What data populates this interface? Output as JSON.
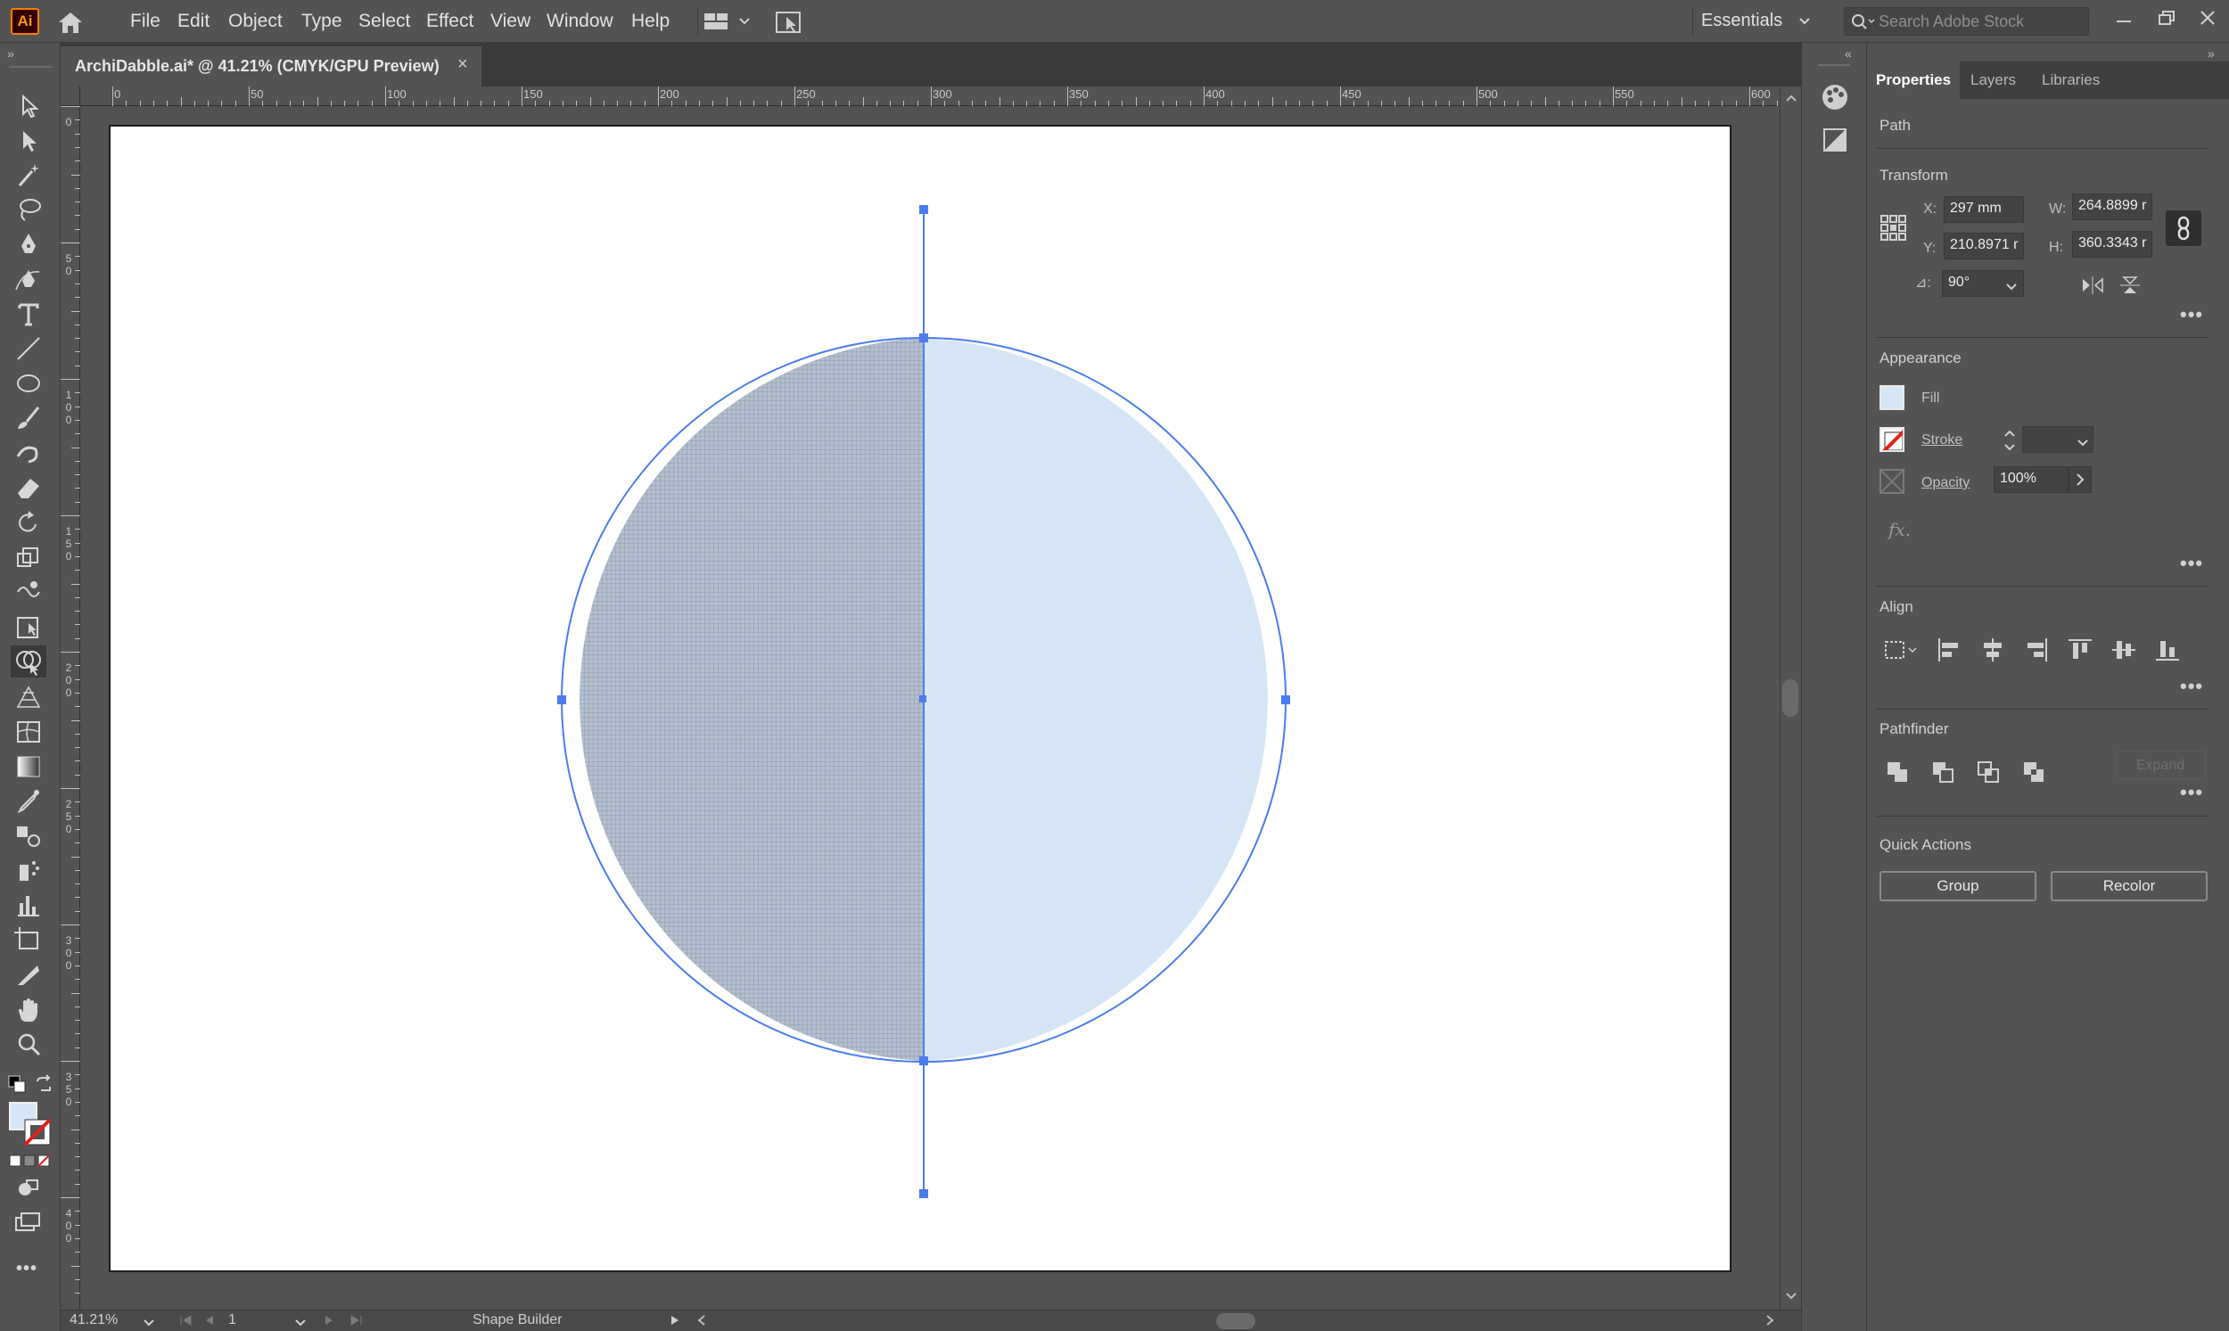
{
  "app": {
    "logo_text": "Ai",
    "workspace": "Essentials"
  },
  "menu": [
    "File",
    "Edit",
    "Object",
    "Type",
    "Select",
    "Effect",
    "View",
    "Window",
    "Help"
  ],
  "search": {
    "placeholder": "Search Adobe Stock"
  },
  "document_tab": {
    "title": "ArchiDabble.ai* @ 41.21% (CMYK/GPU Preview)",
    "close": "×"
  },
  "ruler": {
    "horizontal_labels": [
      "0",
      "50",
      "100",
      "150",
      "200",
      "250",
      "300",
      "350",
      "400",
      "450",
      "500",
      "550",
      "600"
    ],
    "vertical_labels": [
      "0",
      "5 0",
      "1 0 0",
      "1 5 0",
      "2 0 0",
      "2 5 0",
      "3 0 0",
      "3 5 0",
      "4 0 0"
    ]
  },
  "status": {
    "zoom": "41.21%",
    "artboard_number": "1",
    "current_tool": "Shape Builder"
  },
  "panel": {
    "tabs": [
      "Properties",
      "Layers",
      "Libraries"
    ],
    "object_type": "Path",
    "transform": {
      "title": "Transform",
      "x_label": "X:",
      "x_value": "297 mm",
      "y_label": "Y:",
      "y_value": "210.8971 r",
      "w_label": "W:",
      "w_value": "264.8899 r",
      "h_label": "H:",
      "h_value": "360.3343 r",
      "angle_label": "⊿:",
      "angle_value": "90°"
    },
    "appearance": {
      "title": "Appearance",
      "fill_label": "Fill",
      "stroke_label": "Stroke",
      "opacity_label": "Opacity",
      "opacity_value": "100%",
      "fx_label": "fx."
    },
    "align": {
      "title": "Align"
    },
    "pathfinder": {
      "title": "Pathfinder",
      "expand_label": "Expand"
    },
    "quick_actions": {
      "title": "Quick Actions",
      "group_label": "Group",
      "recolor_label": "Recolor"
    },
    "more": "•••"
  },
  "colors": {
    "fill": "#d6e6f7",
    "selection": "#4a7cf0",
    "hatch_half": "#a9b5c4",
    "ui_bg": "#535353"
  },
  "icons": {
    "tools": [
      "selection-tool-icon",
      "direct-selection-tool-icon",
      "magic-wand-tool-icon",
      "lasso-tool-icon",
      "pen-tool-icon",
      "curvature-tool-icon",
      "type-tool-icon",
      "line-segment-tool-icon",
      "ellipse-tool-icon",
      "paintbrush-tool-icon",
      "shaper-tool-icon",
      "eraser-tool-icon",
      "rotate-tool-icon",
      "scale-tool-icon",
      "warp-tool-icon",
      "free-transform-tool-icon",
      "shape-builder-tool-icon",
      "perspective-grid-tool-icon",
      "mesh-tool-icon",
      "gradient-tool-icon",
      "eyedropper-tool-icon",
      "blend-tool-icon",
      "symbol-sprayer-tool-icon",
      "column-graph-tool-icon",
      "artboard-tool-icon",
      "slice-tool-icon",
      "hand-tool-icon",
      "zoom-tool-icon"
    ]
  }
}
